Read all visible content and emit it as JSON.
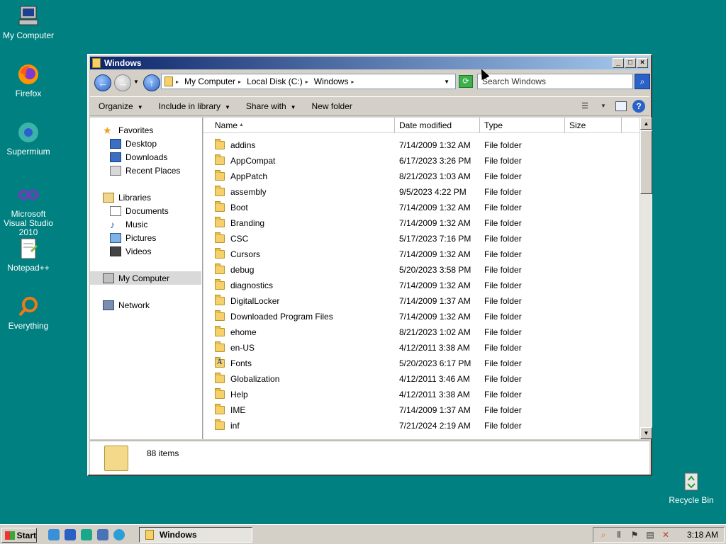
{
  "desktop": {
    "icons": [
      {
        "label": "My Computer"
      },
      {
        "label": "Firefox"
      },
      {
        "label": "Supermium"
      },
      {
        "label": "Microsoft Visual Studio 2010"
      },
      {
        "label": "Notepad++"
      },
      {
        "label": "Everything"
      },
      {
        "label": "Recycle Bin"
      }
    ]
  },
  "window": {
    "title": "Windows",
    "address": {
      "crumbs": [
        "My Computer",
        "Local Disk (C:)",
        "Windows"
      ]
    },
    "search_placeholder": "Search Windows",
    "commands": [
      "Organize",
      "Include in library",
      "Share with",
      "New folder"
    ],
    "nav": {
      "favorites": "Favorites",
      "desktop": "Desktop",
      "downloads": "Downloads",
      "recent": "Recent Places",
      "libraries": "Libraries",
      "documents": "Documents",
      "music": "Music",
      "pictures": "Pictures",
      "videos": "Videos",
      "mycomputer": "My Computer",
      "network": "Network"
    },
    "columns": {
      "name": "Name",
      "date": "Date modified",
      "type": "Type",
      "size": "Size"
    },
    "files": [
      {
        "name": "addins",
        "date": "7/14/2009 1:32 AM",
        "type": "File folder"
      },
      {
        "name": "AppCompat",
        "date": "6/17/2023 3:26 PM",
        "type": "File folder"
      },
      {
        "name": "AppPatch",
        "date": "8/21/2023 1:03 AM",
        "type": "File folder"
      },
      {
        "name": "assembly",
        "date": "9/5/2023 4:22 PM",
        "type": "File folder"
      },
      {
        "name": "Boot",
        "date": "7/14/2009 1:32 AM",
        "type": "File folder"
      },
      {
        "name": "Branding",
        "date": "7/14/2009 1:32 AM",
        "type": "File folder"
      },
      {
        "name": "CSC",
        "date": "5/17/2023 7:16 PM",
        "type": "File folder"
      },
      {
        "name": "Cursors",
        "date": "7/14/2009 1:32 AM",
        "type": "File folder"
      },
      {
        "name": "debug",
        "date": "5/20/2023 3:58 PM",
        "type": "File folder"
      },
      {
        "name": "diagnostics",
        "date": "7/14/2009 1:32 AM",
        "type": "File folder"
      },
      {
        "name": "DigitalLocker",
        "date": "7/14/2009 1:37 AM",
        "type": "File folder"
      },
      {
        "name": "Downloaded Program Files",
        "date": "7/14/2009 1:32 AM",
        "type": "File folder"
      },
      {
        "name": "ehome",
        "date": "8/21/2023 1:02 AM",
        "type": "File folder"
      },
      {
        "name": "en-US",
        "date": "4/12/2011 3:38 AM",
        "type": "File folder"
      },
      {
        "name": "Fonts",
        "date": "5/20/2023 6:17 PM",
        "type": "File folder"
      },
      {
        "name": "Globalization",
        "date": "4/12/2011 3:46 AM",
        "type": "File folder"
      },
      {
        "name": "Help",
        "date": "4/12/2011 3:38 AM",
        "type": "File folder"
      },
      {
        "name": "IME",
        "date": "7/14/2009 1:37 AM",
        "type": "File folder"
      },
      {
        "name": "inf",
        "date": "7/21/2024 2:19 AM",
        "type": "File folder"
      }
    ],
    "details_count": "88 items"
  },
  "taskbar": {
    "start_label": "Start",
    "task_title": "Windows",
    "clock": "3:18 AM"
  }
}
